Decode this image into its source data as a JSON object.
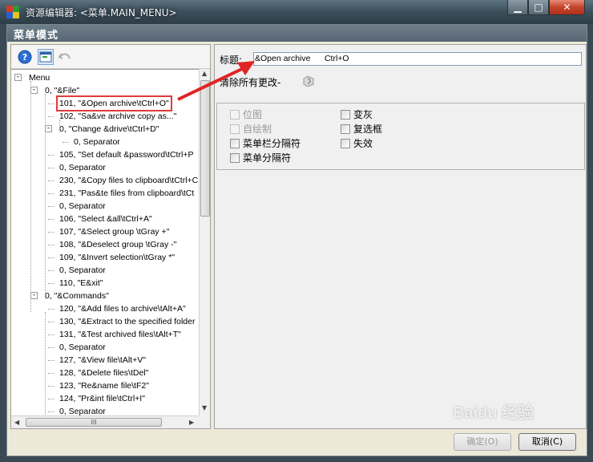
{
  "window": {
    "title": "资源编辑器: <菜单.MAIN_MENU>",
    "min_glyph": "▁",
    "max_glyph": "□",
    "close_glyph": "✕"
  },
  "section_header": "菜单模式",
  "tree": {
    "rows": [
      {
        "text": "Menu",
        "x": 20,
        "toggle": "-"
      },
      {
        "text": "0, \"&File\"",
        "x": 40,
        "toggle": "-"
      },
      {
        "text": "101, \"&Open archive\\tCtrl+O\"",
        "x": 58,
        "selected": true
      },
      {
        "text": "102, \"Sa&ve archive copy as...\"",
        "x": 58
      },
      {
        "text": "0, \"Change &drive\\tCtrl+D\"",
        "x": 58,
        "toggle": "-"
      },
      {
        "text": "0, Separator",
        "x": 76
      },
      {
        "text": "105, \"Set default &password\\tCtrl+P",
        "x": 58
      },
      {
        "text": "0, Separator",
        "x": 58
      },
      {
        "text": "230, \"&Copy files to clipboard\\tCtrl+C",
        "x": 58
      },
      {
        "text": "231, \"Pas&te files from clipboard\\tCt",
        "x": 58
      },
      {
        "text": "0, Separator",
        "x": 58
      },
      {
        "text": "106, \"Select &all\\tCtrl+A\"",
        "x": 58
      },
      {
        "text": "107, \"&Select group    \\tGray +\"",
        "x": 58
      },
      {
        "text": "108, \"&Deselect group  \\tGray -\"",
        "x": 58
      },
      {
        "text": "109, \"&Invert selection\\tGray *\"",
        "x": 58
      },
      {
        "text": "0, Separator",
        "x": 58
      },
      {
        "text": "110, \"E&xit\"",
        "x": 58
      },
      {
        "text": "0, \"&Commands\"",
        "x": 40,
        "toggle": "-"
      },
      {
        "text": "120, \"&Add files to archive\\tAlt+A\"",
        "x": 58
      },
      {
        "text": "130, \"&Extract to the specified folder",
        "x": 58
      },
      {
        "text": "131, \"&Test archived files\\tAlt+T\"",
        "x": 58
      },
      {
        "text": "0, Separator",
        "x": 58
      },
      {
        "text": "127, \"&View file\\tAlt+V\"",
        "x": 58
      },
      {
        "text": "128, \"&Delete files\\tDel\"",
        "x": 58
      },
      {
        "text": "123, \"Re&name file\\tF2\"",
        "x": 58
      },
      {
        "text": "124, \"Pr&int file\\tCtrl+I\"",
        "x": 58
      },
      {
        "text": "0, Separator",
        "x": 58
      }
    ],
    "hscroll_grip": "III"
  },
  "editor": {
    "title_label": "标题:",
    "title_value": "&Open archive      Ctrl+O",
    "clear_label": "清除所有更改-",
    "options": [
      {
        "label": "位图",
        "checked": false,
        "disabled": true
      },
      {
        "label": "变灰",
        "checked": false,
        "disabled": false
      },
      {
        "label": "自绘制",
        "checked": false,
        "disabled": true
      },
      {
        "label": "复选框",
        "checked": false,
        "disabled": false
      },
      {
        "label": "菜单栏分隔符",
        "checked": false,
        "disabled": false
      },
      {
        "label": "失效",
        "checked": false,
        "disabled": false
      },
      {
        "label": "菜单分隔符",
        "checked": false,
        "disabled": false
      }
    ]
  },
  "buttons": {
    "ok": "确定(O)",
    "cancel": "取消(C)"
  },
  "watermark": "Baidu 经验",
  "colors": {
    "accent_red": "#e03c3c",
    "header_bg": "#566672"
  }
}
